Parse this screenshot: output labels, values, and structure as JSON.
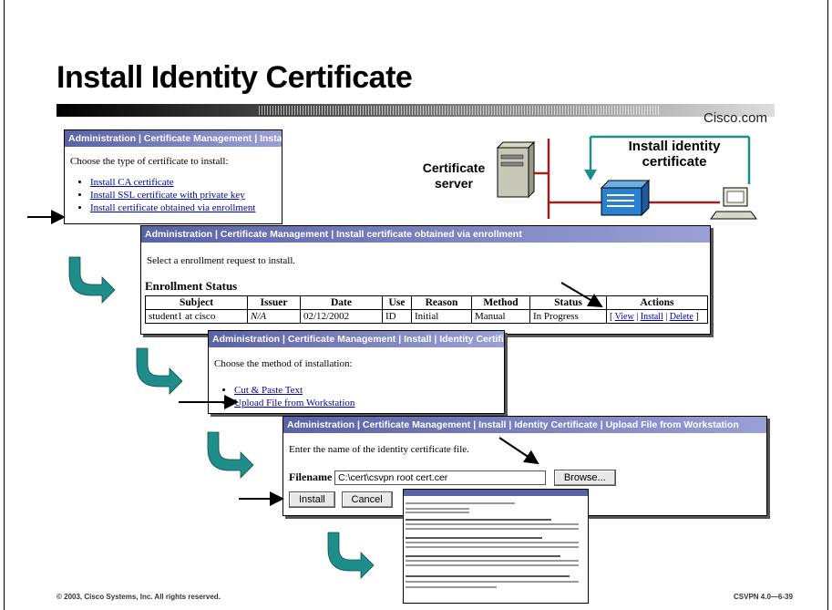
{
  "slide": {
    "title": "Install Identity Certificate",
    "brand": "Cisco.com",
    "footer_left": "© 2003, Cisco Systems, Inc. All rights reserved.",
    "footer_right": "CSVPN 4.0—6-39"
  },
  "diagram": {
    "server_label_1": "Certificate",
    "server_label_2": "server",
    "callout_1": "Install identity",
    "callout_2": "certificate"
  },
  "panel1": {
    "header": "Administration | Certificate Management | Install",
    "prompt": "Choose the type of certificate to install:",
    "options": [
      "Install CA certificate",
      "Install SSL certificate with private key",
      "Install certificate obtained via enrollment"
    ]
  },
  "panel2": {
    "header": "Administration | Certificate Management | Install certificate obtained via enrollment",
    "prompt": "Select a enrollment request to install.",
    "section": "Enrollment Status",
    "columns": [
      "Subject",
      "Issuer",
      "Date",
      "Use",
      "Reason",
      "Method",
      "Status",
      "Actions"
    ],
    "row": {
      "subject": "student1 at cisco",
      "issuer": "N/A",
      "date": "02/12/2002",
      "use": "ID",
      "reason": "Initial",
      "method": "Manual",
      "status": "In Progress"
    },
    "actions": {
      "open": "[ ",
      "view": "View",
      "sep1": " | ",
      "install": "Install",
      "sep2": " | ",
      "delete": "Delete",
      "close": " ]"
    }
  },
  "panel3": {
    "header": "Administration | Certificate Management | Install | Identity Certificate",
    "prompt": "Choose the method of installation:",
    "options": [
      "Cut & Paste Text",
      "Upload File from Workstation"
    ]
  },
  "panel4": {
    "header": "Administration | Certificate Management | Install | Identity Certificate | Upload File from Workstation",
    "prompt": "Enter the name of the identity certificate file.",
    "filename_label": "Filename",
    "filename_value": "C:\\cert\\csvpn root cert.cer",
    "browse_label": "Browse...",
    "install_label": "Install",
    "cancel_label": "Cancel"
  },
  "colors": {
    "header_start": "#5a62a8",
    "header_end": "#9aa0d6",
    "arrow_teal": "#1f8e8a",
    "link": "#0000aa"
  }
}
